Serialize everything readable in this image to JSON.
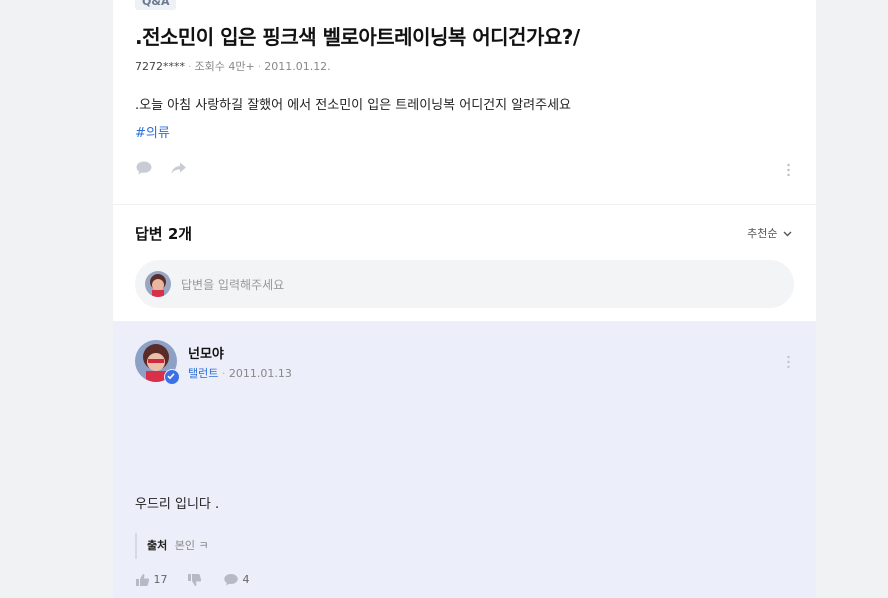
{
  "question": {
    "badge": "Q&A",
    "title": ".전소민이 입은 핑크색 벨로아트레이닝복 어디건가요?/",
    "author": "7272****",
    "views": "조회수 4만+",
    "date": "2011.01.12.",
    "body": ".오늘 아침 사랑하길 잘했어 에서 전소민이 입은 트레이닝복 어디건지 알려주세요",
    "tag": "#의류"
  },
  "answers_section": {
    "count_label": "답변 2개",
    "sort_label": "추천순",
    "input_placeholder": "답변을 입력해주세요"
  },
  "answer": {
    "name": "넌모야",
    "role": "탤런트",
    "date": "2011.01.13",
    "text": "우드리 입니다 .",
    "source_label": "출처",
    "source_value": "본인 ㅋ",
    "likes": "17",
    "comments": "4"
  },
  "colors": {
    "accent": "#2f6fd8",
    "answer_bg": "#eceef9",
    "verified": "#3a71e8"
  }
}
